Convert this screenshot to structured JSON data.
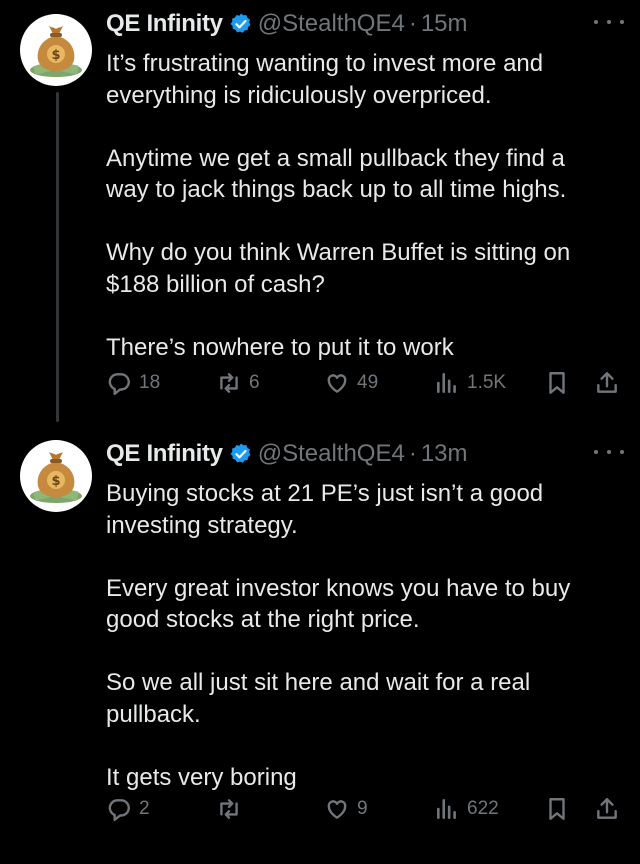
{
  "tweets": [
    {
      "author": {
        "name": "QE Infinity",
        "handle": "@StealthQE4"
      },
      "separator": "·",
      "time": "15m",
      "paragraphs": [
        "It’s frustrating wanting to invest more and everything is ridiculously overpriced.",
        "Anytime we get a small pullback they find a way to jack things back up to all time highs.",
        "Why do you think Warren Buffet is sitting on $188 billion of cash?",
        "There’s nowhere to put it to work"
      ],
      "stats": {
        "replies": "18",
        "reposts": "6",
        "likes": "49",
        "views": "1.5K"
      }
    },
    {
      "author": {
        "name": "QE Infinity",
        "handle": "@StealthQE4"
      },
      "separator": "·",
      "time": "13m",
      "paragraphs": [
        "Buying stocks at 21 PE’s just isn’t a good investing strategy.",
        "Every great investor knows you have to buy good stocks at the right price.",
        "So we all just sit here and wait for a real pullback.",
        "It gets very boring"
      ],
      "stats": {
        "replies": "2",
        "reposts": "",
        "likes": "9",
        "views": "622"
      }
    }
  ],
  "icons": {
    "avatar": "money-bag-icon",
    "verified": "verified-badge-icon",
    "more": "more-icon",
    "reply": "reply-icon",
    "repost": "repost-icon",
    "like": "like-icon",
    "views": "views-icon",
    "bookmark": "bookmark-icon",
    "share": "share-icon"
  },
  "colors": {
    "background": "#000000",
    "text": "#e7e9ea",
    "muted": "#71767b",
    "verified": "#1d9bf0",
    "thread_line": "#333639"
  }
}
